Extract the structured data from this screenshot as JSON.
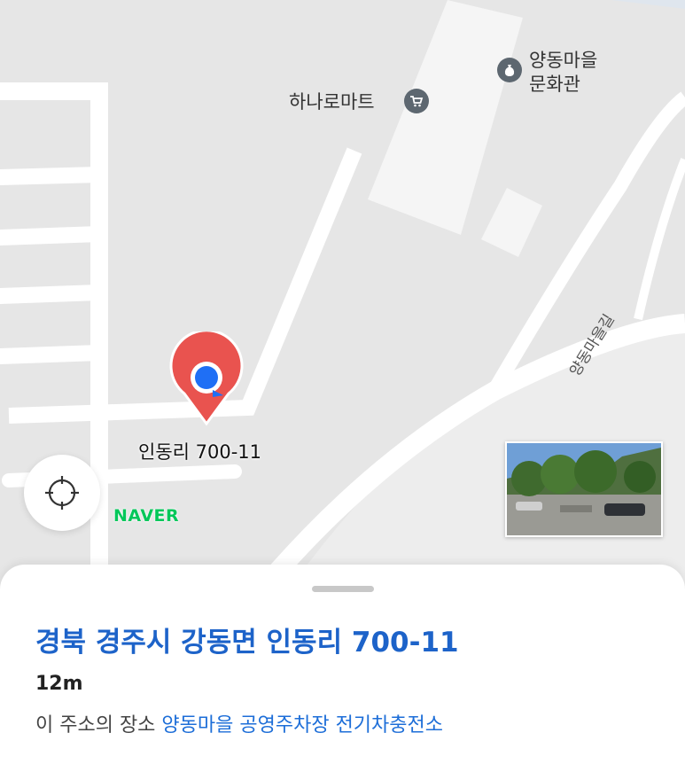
{
  "map": {
    "provider": "NAVER",
    "pois": {
      "mart": {
        "label": "하나로마트",
        "icon": "shopping-cart-icon"
      },
      "culture_hall": {
        "label_line1": "양동마을",
        "label_line2": "문화관",
        "icon": "money-bag-icon"
      }
    },
    "road_label": "양동마을길",
    "pin": {
      "label": "인동리 700-11",
      "color": "#e9534f",
      "location_dot_color": "#1f6ff5"
    }
  },
  "colors": {
    "map_background": "#e6e6e6",
    "road": "#ffffff",
    "building": "#f4f4f4",
    "address_blue": "#1d63c9"
  },
  "sheet": {
    "address": "경북 경주시 강동면 인동리 700-11",
    "distance": "12m",
    "place_prefix": "이 주소의 장소",
    "place_name": "양동마을 공영주차장 전기차충전소"
  }
}
